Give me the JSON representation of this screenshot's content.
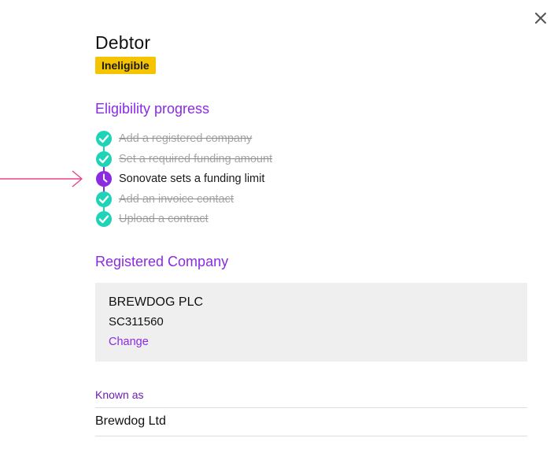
{
  "colors": {
    "accent": "#8a2be2",
    "accent_dark": "#6b1fb0",
    "done": "#1fd3b8",
    "badge": "#f5c400",
    "arrow": "#e8428a"
  },
  "header": {
    "title": "Debtor",
    "status_badge": "Ineligible"
  },
  "eligibility": {
    "heading": "Eligibility progress",
    "steps": [
      {
        "label": "Add a registered company",
        "state": "done",
        "icon": "check-circle-icon"
      },
      {
        "label": "Set a required funding amount",
        "state": "done",
        "icon": "check-circle-icon"
      },
      {
        "label": "Sonovate sets a funding limit",
        "state": "current",
        "icon": "clock-icon"
      },
      {
        "label": "Add an invoice contact",
        "state": "done",
        "icon": "check-circle-icon"
      },
      {
        "label": "Upload a contract",
        "state": "done",
        "icon": "check-circle-icon"
      }
    ]
  },
  "registered_company": {
    "heading": "Registered Company",
    "name": "BREWDOG PLC",
    "number": "SC311560",
    "change_label": "Change"
  },
  "known_as": {
    "label": "Known as",
    "value": "Brewdog Ltd"
  }
}
